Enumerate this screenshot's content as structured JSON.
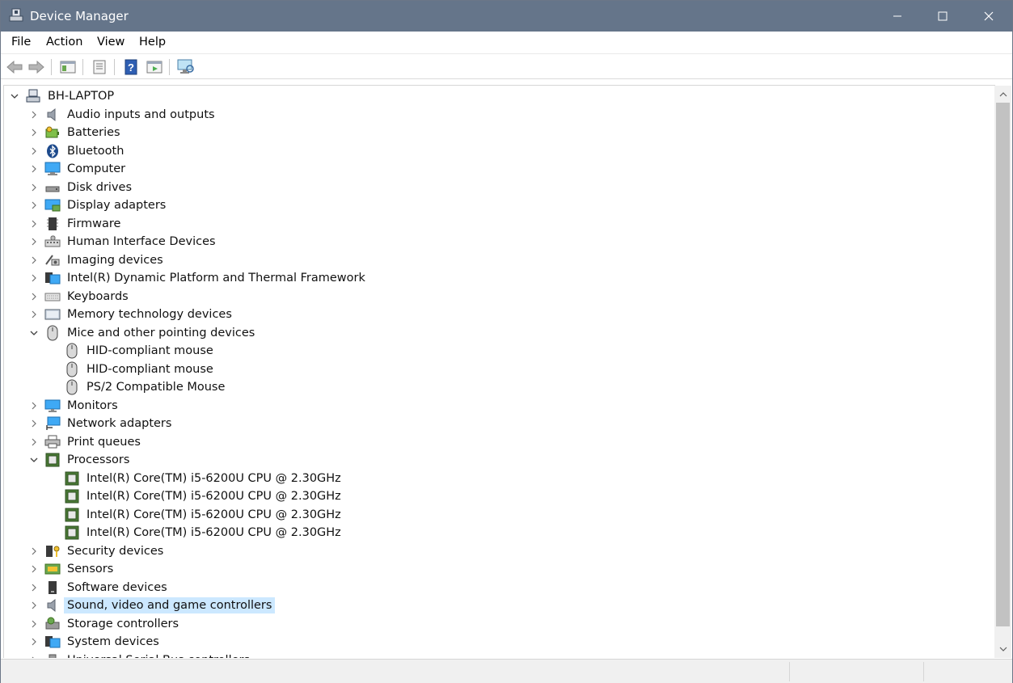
{
  "window": {
    "title": "Device Manager"
  },
  "menu": [
    "File",
    "Action",
    "View",
    "Help"
  ],
  "toolbar": [
    "back-icon",
    "forward-icon",
    "show-hide-console-tree-icon",
    "properties-icon",
    "help-icon",
    "run-icon",
    "scan-hardware-changes-icon"
  ],
  "tree": {
    "root": "BH-LAPTOP",
    "items": [
      {
        "label": "Audio inputs and outputs",
        "icon": "speaker-icon",
        "expanded": false
      },
      {
        "label": "Batteries",
        "icon": "battery-icon",
        "expanded": false
      },
      {
        "label": "Bluetooth",
        "icon": "bluetooth-icon",
        "expanded": false
      },
      {
        "label": "Computer",
        "icon": "computer-icon",
        "expanded": false
      },
      {
        "label": "Disk drives",
        "icon": "disk-drive-icon",
        "expanded": false
      },
      {
        "label": "Display adapters",
        "icon": "display-adapter-icon",
        "expanded": false
      },
      {
        "label": "Firmware",
        "icon": "firmware-icon",
        "expanded": false
      },
      {
        "label": "Human Interface Devices",
        "icon": "hid-icon",
        "expanded": false
      },
      {
        "label": "Imaging devices",
        "icon": "camera-icon",
        "expanded": false
      },
      {
        "label": "Intel(R) Dynamic Platform and Thermal Framework",
        "icon": "system-folder-icon",
        "expanded": false
      },
      {
        "label": "Keyboards",
        "icon": "keyboard-icon",
        "expanded": false
      },
      {
        "label": "Memory technology devices",
        "icon": "memory-icon",
        "expanded": false
      },
      {
        "label": "Mice and other pointing devices",
        "icon": "mouse-icon",
        "expanded": true,
        "children": [
          "HID-compliant mouse",
          "HID-compliant mouse",
          "PS/2 Compatible Mouse"
        ]
      },
      {
        "label": "Monitors",
        "icon": "monitor-icon",
        "expanded": false
      },
      {
        "label": "Network adapters",
        "icon": "network-icon",
        "expanded": false
      },
      {
        "label": "Print queues",
        "icon": "printer-icon",
        "expanded": false
      },
      {
        "label": "Processors",
        "icon": "processor-icon",
        "expanded": true,
        "children": [
          "Intel(R) Core(TM) i5-6200U CPU @ 2.30GHz",
          "Intel(R) Core(TM) i5-6200U CPU @ 2.30GHz",
          "Intel(R) Core(TM) i5-6200U CPU @ 2.30GHz",
          "Intel(R) Core(TM) i5-6200U CPU @ 2.30GHz"
        ]
      },
      {
        "label": "Security devices",
        "icon": "security-key-icon",
        "expanded": false
      },
      {
        "label": "Sensors",
        "icon": "sensor-icon",
        "expanded": false
      },
      {
        "label": "Software devices",
        "icon": "software-device-icon",
        "expanded": false
      },
      {
        "label": "Sound, video and game controllers",
        "icon": "speaker-icon",
        "expanded": false,
        "selected": true
      },
      {
        "label": "Storage controllers",
        "icon": "storage-controller-icon",
        "expanded": false
      },
      {
        "label": "System devices",
        "icon": "system-folder-icon",
        "expanded": false
      },
      {
        "label": "Universal Serial Bus controllers",
        "icon": "usb-icon",
        "expanded": false
      }
    ]
  },
  "colors": {
    "titlebar": "#65758a",
    "selection": "#cce8ff",
    "accent": "#1f78d1"
  }
}
